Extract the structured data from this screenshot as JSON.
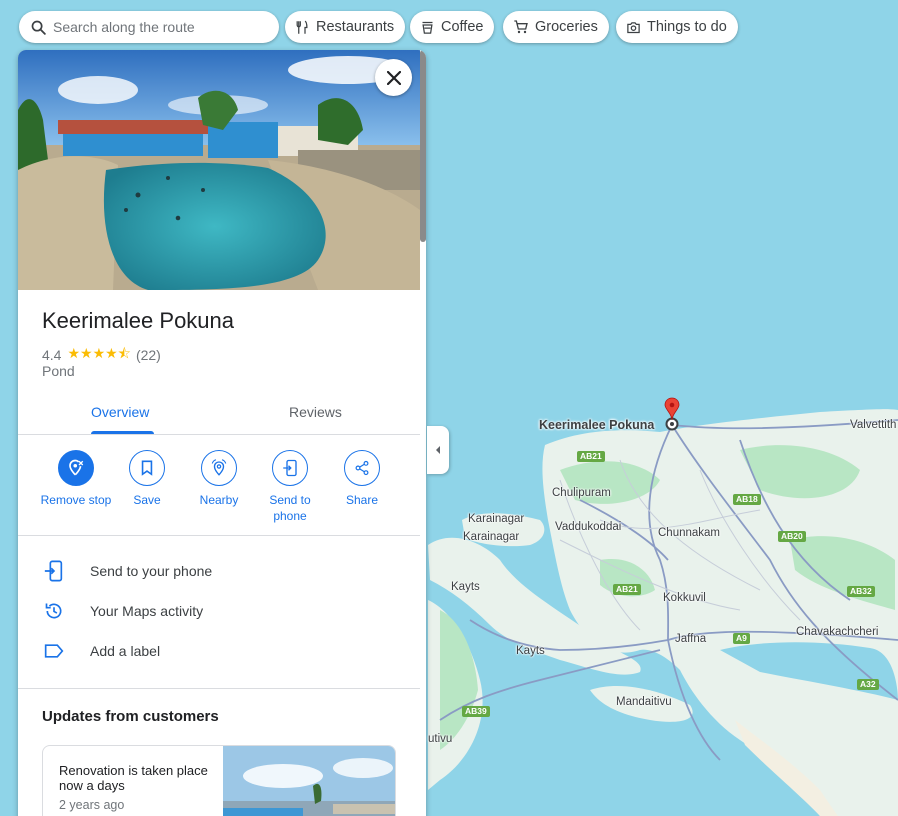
{
  "search": {
    "placeholder": "Search along the route"
  },
  "chips": [
    {
      "label": "Restaurants",
      "icon": "fork-knife-icon"
    },
    {
      "label": "Coffee",
      "icon": "coffee-cup-icon"
    },
    {
      "label": "Groceries",
      "icon": "shopping-cart-icon"
    },
    {
      "label": "Things to do",
      "icon": "camera-icon"
    }
  ],
  "place": {
    "name": "Keerimalee Pokuna",
    "rating": "4.4",
    "stars": "★★★★⯪",
    "review_count": "(22)",
    "category": "Pond"
  },
  "tabs": [
    {
      "label": "Overview",
      "active": true
    },
    {
      "label": "Reviews",
      "active": false
    }
  ],
  "actions": [
    {
      "label": "Remove stop",
      "icon": "remove-pin-icon"
    },
    {
      "label": "Save",
      "icon": "bookmark-icon"
    },
    {
      "label": "Nearby",
      "icon": "nearby-icon"
    },
    {
      "label": "Send to phone",
      "icon": "send-to-phone-icon"
    },
    {
      "label": "Share",
      "icon": "share-icon"
    }
  ],
  "rows": [
    {
      "label": "Send to your phone",
      "icon": "phone-icon"
    },
    {
      "label": "Your Maps activity",
      "icon": "history-icon"
    },
    {
      "label": "Add a label",
      "icon": "label-icon"
    }
  ],
  "updates": {
    "title": "Updates from customers",
    "post_text": "Renovation is taken place now a days",
    "post_time": "2 years ago"
  },
  "map": {
    "pin_label": "Keerimalee Pokuna",
    "places": [
      "Valvettith",
      "Chulipuram",
      "Karainagar",
      "Karainagar",
      "Vaddukoddai",
      "Chunnakam",
      "Kayts",
      "Kokkuvil",
      "Jaffna",
      "Chavakachcheri",
      "Kayts",
      "Mandaitivu",
      "utivu"
    ],
    "roads": [
      "AB21",
      "AB18",
      "AB20",
      "AB21",
      "AB32",
      "A9",
      "A32",
      "AB39"
    ]
  },
  "colors": {
    "accent": "#1a73e8",
    "water": "#8fd4e8",
    "land": "#e9f2ec",
    "park": "#b8e6c4",
    "pin": "#ea4335",
    "star": "#fbbc04"
  }
}
